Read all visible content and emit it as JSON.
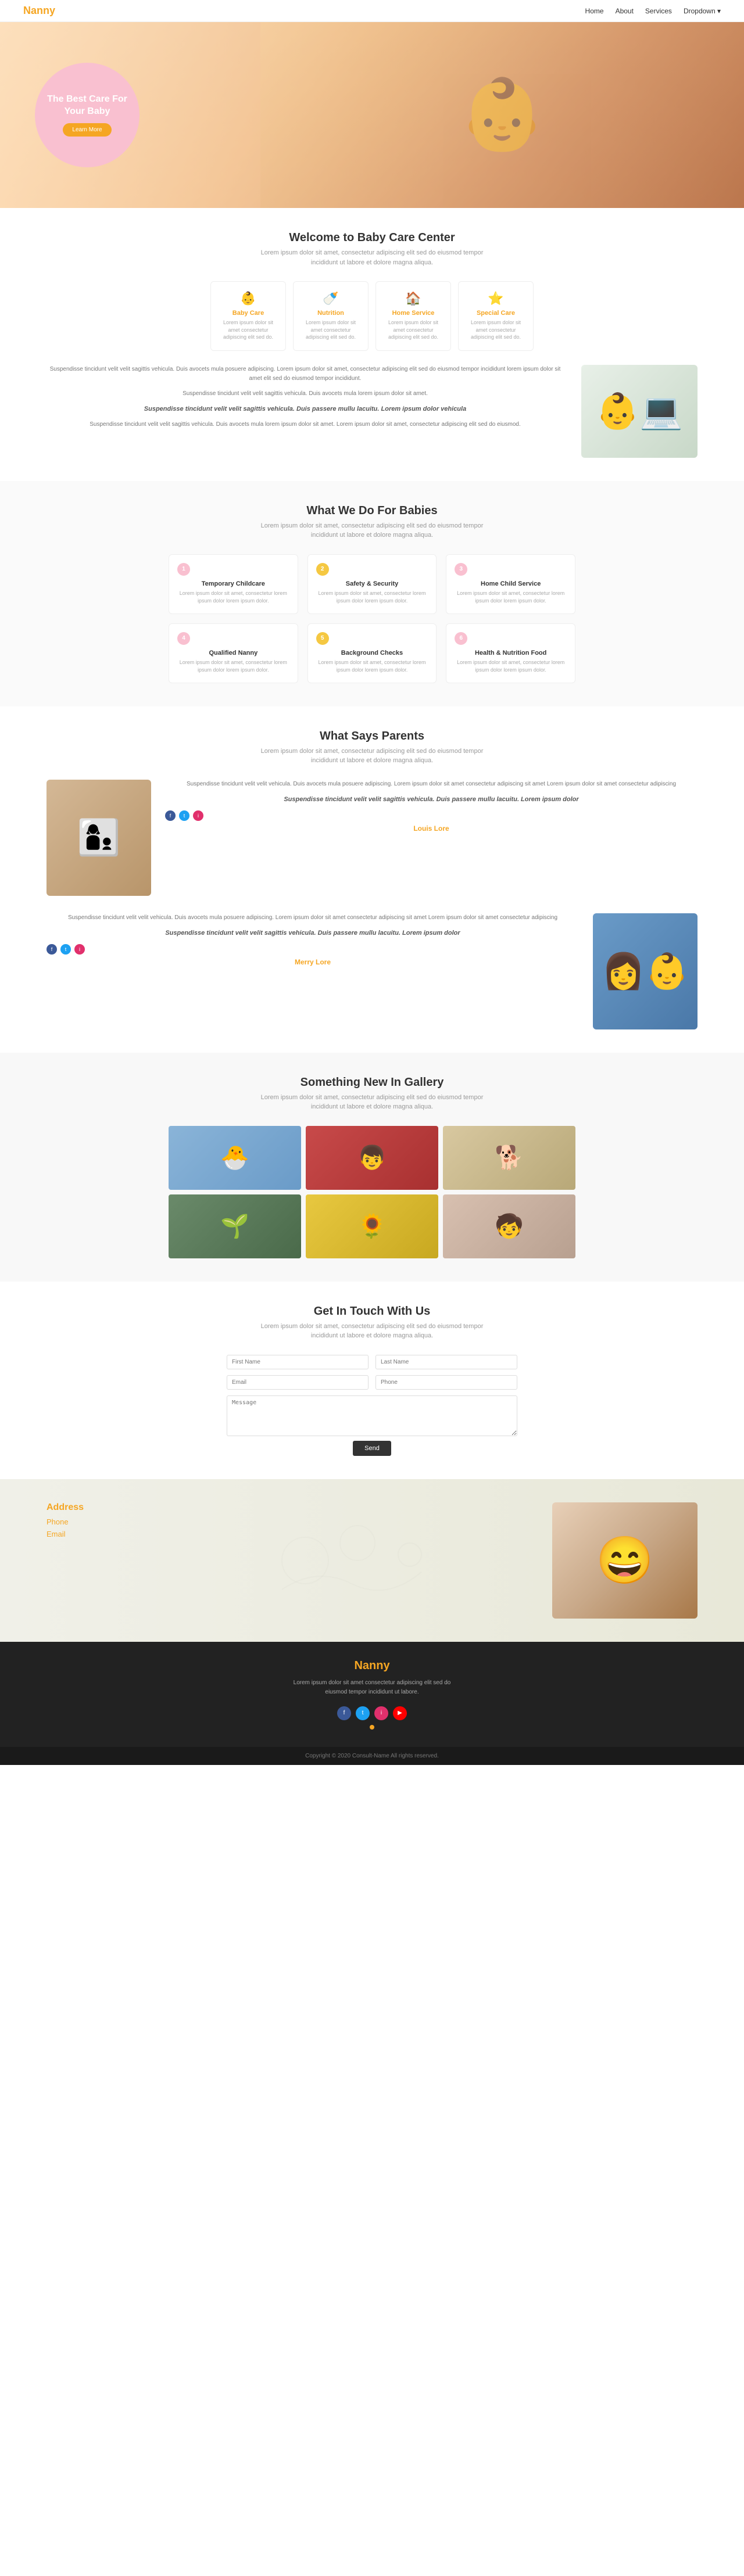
{
  "nav": {
    "logo": "Nanny",
    "links": [
      "Home",
      "About",
      "Services",
      "Dropdown ▾"
    ]
  },
  "hero": {
    "title": "The Best Care For Your Baby",
    "button": "Learn More"
  },
  "welcome": {
    "section_title": "Welcome to Baby Care Center",
    "section_subtitle": "Lorem ipsum dolor sit amet, consectetur adipiscing elit sed do eiusmod tempor incididunt ut labore et dolore magna aliqua.",
    "cards": [
      {
        "icon": "👶",
        "title": "Baby Care",
        "desc": "Lorem ipsum dolor sit amet consectetur adipiscing elit sed do."
      },
      {
        "icon": "🍼",
        "title": "Nutrition",
        "desc": "Lorem ipsum dolor sit amet consectetur adipiscing elit sed do."
      },
      {
        "icon": "🏠",
        "title": "Home Service",
        "desc": "Lorem ipsum dolor sit amet consectetur adipiscing elit sed do."
      },
      {
        "icon": "⭐",
        "title": "Special Care",
        "desc": "Lorem ipsum dolor sit amet consectetur adipiscing elit sed do."
      }
    ],
    "text1": "Suspendisse tincidunt velit velit sagittis vehicula. Duis avocets mula posuere adipiscing. Lorem ipsum dolor sit amet, consectetur adipiscing elit sed do eiusmod tempor incididunt lorem ipsum dolor sit amet elit sed do eiusmod tempor incididunt.",
    "text2": "Suspendisse tincidunt velit velit sagittis vehicula. Duis avocets mula lorem ipsum dolor sit amet.",
    "text3": "Suspendisse tincidunt velit velit sagittis vehicula. Duis avocets mula lorem ipsum dolor sit amet. Lorem ipsum dolor sit amet, consectetur adipiscing elit sed do eiusmod.",
    "quote": "Suspendisse tincidunt velit velit sagittis vehicula. Duis passere mullu lacuitu. Lorem ipsum dolor vehicula"
  },
  "what_we_do": {
    "section_title": "What We Do For Babies",
    "section_subtitle": "Lorem ipsum dolor sit amet, consectetur adipiscing elit sed do eiusmod tempor incididunt ut labore et dolore magna aliqua.",
    "services": [
      {
        "num": "1",
        "title": "Temporary Childcare",
        "desc": "Lorem ipsum dolor sit amet, consectetur lorem ipsum dolor lorem ipsum dolor."
      },
      {
        "num": "2",
        "title": "Safety & Security",
        "desc": "Lorem ipsum dolor sit amet, consectetur lorem ipsum dolor lorem ipsum dolor."
      },
      {
        "num": "3",
        "title": "Home Child Service",
        "desc": "Lorem ipsum dolor sit amet, consectetur lorem ipsum dolor lorem ipsum dolor."
      },
      {
        "num": "4",
        "title": "Qualified Nanny",
        "desc": "Lorem ipsum dolor sit amet, consectetur lorem ipsum dolor lorem ipsum dolor."
      },
      {
        "num": "5",
        "title": "Background Checks",
        "desc": "Lorem ipsum dolor sit amet, consectetur lorem ipsum dolor lorem ipsum dolor."
      },
      {
        "num": "6",
        "title": "Health & Nutrition Food",
        "desc": "Lorem ipsum dolor sit amet, consectetur lorem ipsum dolor lorem ipsum dolor."
      }
    ]
  },
  "parents": {
    "section_title": "What Says Parents",
    "section_subtitle": "Lorem ipsum dolor sit amet, consectetur adipiscing elit sed do eiusmod tempor incididunt ut labore et dolore magna aliqua.",
    "testimonials": [
      {
        "text": "Suspendisse tincidunt velit velit vehicula. Duis avocets mula posuere adipiscing. Lorem ipsum dolor sit amet consectetur adipiscing sit amet Lorem ipsum dolor sit amet consectetur adipiscing",
        "quote": "Suspendisse tincidunt velit velit sagittis vehicula. Duis passere mullu lacuitu. Lorem ipsum dolor",
        "name": "Louis Lore",
        "photo_emoji": "👩‍👦"
      },
      {
        "text": "Suspendisse tincidunt velit velit vehicula. Duis avocets mula posuere adipiscing. Lorem ipsum dolor sit amet consectetur adipiscing sit amet Lorem ipsum dolor sit amet consectetur adipiscing",
        "quote": "Suspendisse tincidunt velit velit sagittis vehicula. Duis passere mullu lacuitu. Lorem ipsum dolor",
        "name": "Merry Lore",
        "photo_emoji": "👩‍👶"
      }
    ]
  },
  "gallery": {
    "section_title": "Something New In Gallery",
    "section_subtitle": "Lorem ipsum dolor sit amet, consectetur adipiscing elit sed do eiusmod tempor incididunt ut labore et dolore magna aliqua.",
    "items": [
      "🐣",
      "👦",
      "🐕",
      "🌱",
      "🌻",
      "🧒"
    ]
  },
  "contact": {
    "section_title": "Get In Touch With Us",
    "section_subtitle": "Lorem ipsum dolor sit amet, consectetur adipiscing elit sed do eiusmod tempor incididunt ut labore et dolore magna aliqua.",
    "form": {
      "first_name_placeholder": "First Name",
      "last_name_placeholder": "Last Name",
      "email_placeholder": "Email",
      "phone_placeholder": "Phone",
      "message_placeholder": "Message",
      "submit_label": "Send"
    }
  },
  "contact_bar": {
    "address_label": "Address",
    "phone_label": "Phone",
    "email_label": "Email"
  },
  "footer": {
    "logo": "Nanny",
    "text": "Lorem ipsum dolor sit amet consectetur adipiscing elit sed do eiusmod tempor incididunt ut labore.",
    "copyright": "Copyright © 2020 Consult-Name All rights reserved."
  }
}
